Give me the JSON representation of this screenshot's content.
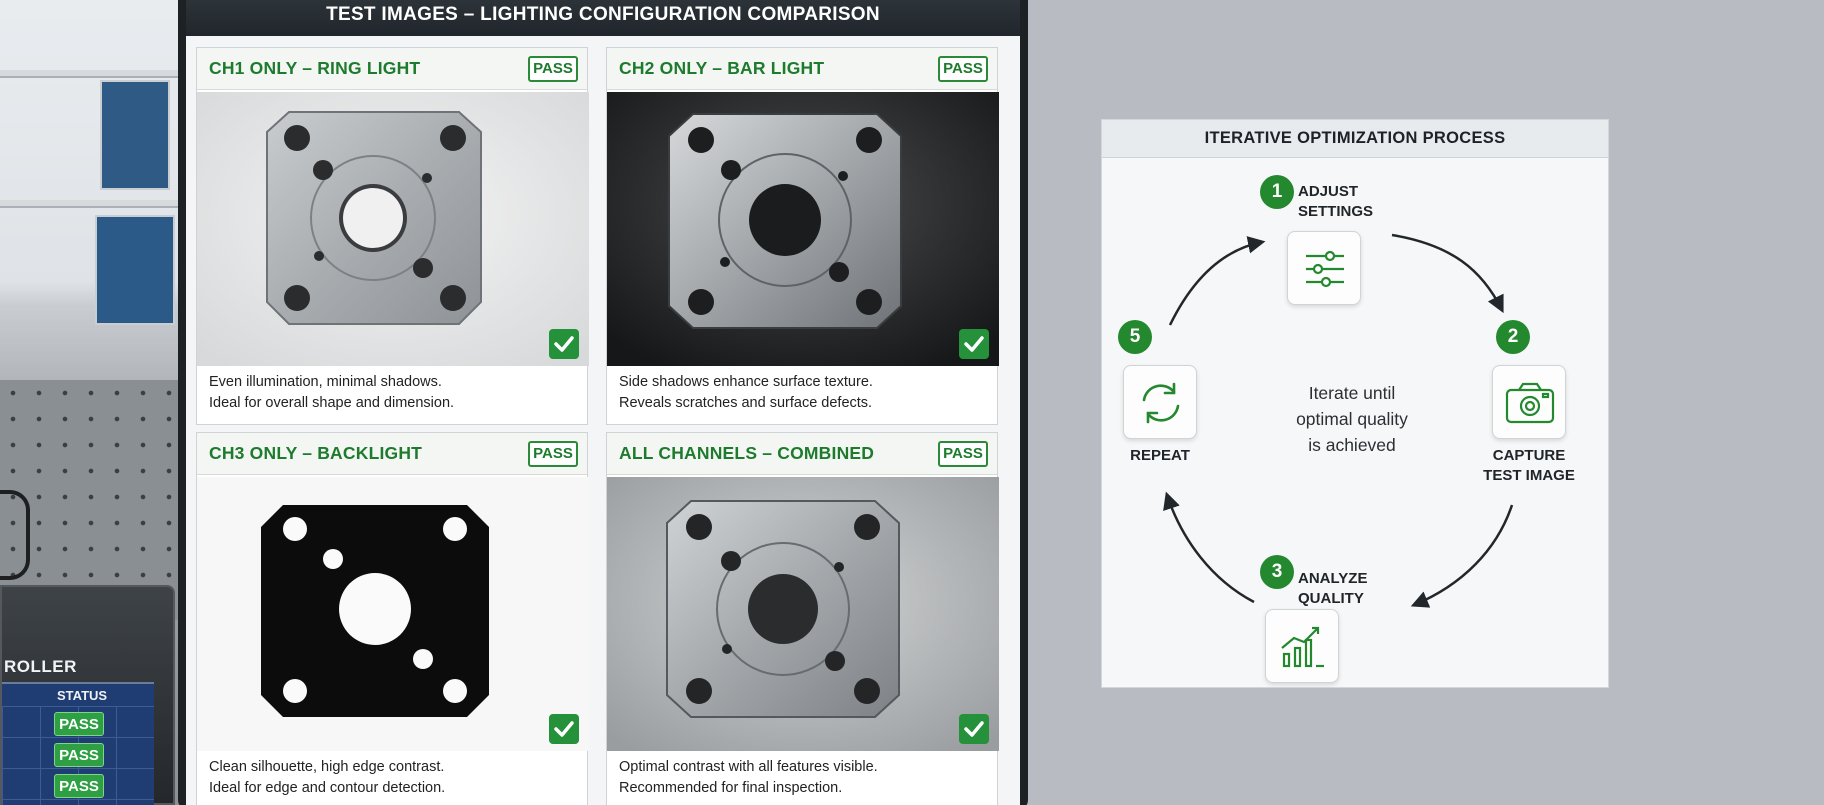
{
  "monitor": {
    "header_title": "TEST IMAGES – LIGHTING CONFIGURATION COMPARISON",
    "panels": [
      {
        "title": "CH1 ONLY – RING LIGHT",
        "badge": "PASS",
        "desc_line1": "Even illumination, minimal shadows.",
        "desc_line2": "Ideal for overall shape and dimension.",
        "icon": "check-icon"
      },
      {
        "title": "CH2 ONLY – BAR LIGHT",
        "badge": "PASS",
        "desc_line1": "Side shadows enhance surface texture.",
        "desc_line2": "Reveals scratches and surface defects.",
        "icon": "check-icon"
      },
      {
        "title": "CH3 ONLY – BACKLIGHT",
        "badge": "PASS",
        "desc_line1": "Clean silhouette, high edge contrast.",
        "desc_line2": "Ideal for edge and contour detection.",
        "icon": "check-icon"
      },
      {
        "title": "ALL CHANNELS – COMBINED",
        "badge": "PASS",
        "desc_line1": "Optimal contrast with all features visible.",
        "desc_line2": "Recommended for final inspection.",
        "icon": "check-icon"
      }
    ]
  },
  "controller": {
    "title": "ROLLER",
    "status_header": "STATUS",
    "status_values": [
      "PASS",
      "PASS",
      "PASS"
    ]
  },
  "process": {
    "title": "ITERATIVE OPTIMIZATION PROCESS",
    "center_line1": "Iterate until",
    "center_line2": "optimal quality",
    "center_line3": "is achieved",
    "steps": [
      {
        "number": "1",
        "line1": "ADJUST",
        "line2": "SETTINGS",
        "icon": "sliders-icon"
      },
      {
        "number": "2",
        "line1": "CAPTURE",
        "line2": "TEST IMAGE",
        "icon": "camera-icon"
      },
      {
        "number": "3",
        "line1": "ANALYZE",
        "line2": "QUALITY",
        "icon": "chart-icon"
      },
      {
        "number": "5",
        "line1": "REPEAT",
        "line2": "",
        "icon": "refresh-icon"
      }
    ]
  },
  "colors": {
    "accent_green": "#24882f",
    "header_dark": "#20262b",
    "controller_screen": "#1f3d72"
  }
}
